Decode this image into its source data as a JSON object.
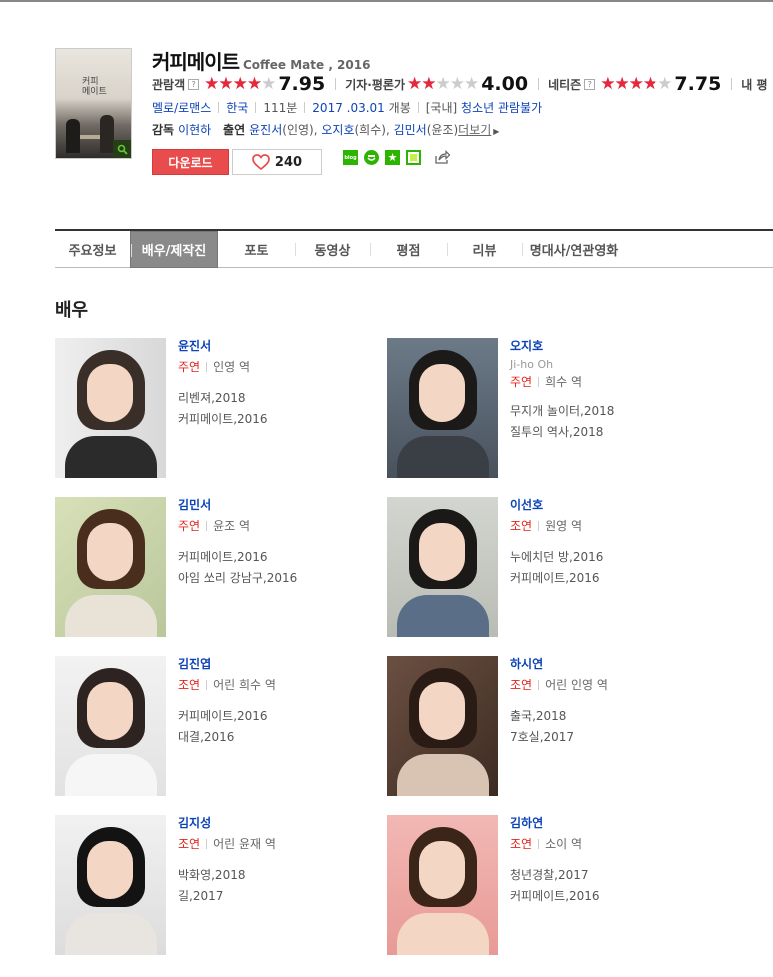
{
  "movie": {
    "title_ko": "커피메이트",
    "title_en": "Coffee Mate , 2016",
    "poster_text": "커피\n메이트",
    "ratings": [
      {
        "label": "관람객",
        "help": "?",
        "score": "7.95",
        "fill": 0.795
      },
      {
        "label": "기자·평론가",
        "help": "",
        "score": "4.00",
        "fill": 0.4
      },
      {
        "label": "네티즌",
        "help": "?",
        "score": "7.75",
        "fill": 0.775
      },
      {
        "label": "내 평",
        "help": "",
        "score": "",
        "fill": 0
      }
    ],
    "genre": "멜로/로맨스",
    "country": "한국",
    "runtime": "111분",
    "release_date": "2017 .03.01",
    "release_suffix": "개봉",
    "grade_prefix": "[국내]",
    "grade": "청소년 관람불가",
    "director_label": "감독",
    "director": "이현하",
    "cast_label": "출연",
    "cast_summary": [
      {
        "name": "윤진서",
        "role": "(인영)",
        "sep": ", "
      },
      {
        "name": "오지호",
        "role": "(희수)",
        "sep": ", "
      },
      {
        "name": "김민서",
        "role": "(윤조)",
        "sep": ""
      }
    ],
    "more_label": "더보기",
    "more_icon": "triangle-right-icon"
  },
  "actions": {
    "download_label": "다운로드",
    "like_count": "240",
    "like_icon": "heart-icon",
    "share_icons": [
      "blog-icon",
      "band-icon",
      "bookmark-star-icon",
      "memo-icon",
      "share-icon"
    ],
    "blog_text": "blog"
  },
  "tabs": [
    {
      "label": "주요정보",
      "active": false
    },
    {
      "label": "배우/제작진",
      "active": true
    },
    {
      "label": "포토",
      "active": false
    },
    {
      "label": "동영상",
      "active": false
    },
    {
      "label": "평점",
      "active": false
    },
    {
      "label": "리뷰",
      "active": false
    },
    {
      "label": "명대사/연관영화",
      "active": false
    }
  ],
  "section_title": "배우",
  "actors": [
    {
      "name": "윤진서",
      "en": "",
      "role_type": "주연",
      "role": "인영 역",
      "works": [
        "리벤져,2018",
        "커피메이트,2016"
      ]
    },
    {
      "name": "오지호",
      "en": "Ji-ho Oh",
      "role_type": "주연",
      "role": "희수 역",
      "works": [
        "무지개 놀이터,2018",
        "질투의 역사,2018"
      ]
    },
    {
      "name": "김민서",
      "en": "",
      "role_type": "주연",
      "role": "윤조 역",
      "works": [
        "커피메이트,2016",
        "아임 쏘리 강남구,2016"
      ]
    },
    {
      "name": "이선호",
      "en": "",
      "role_type": "조연",
      "role": "원영 역",
      "works": [
        "누에치던 방,2016",
        "커피메이트,2016"
      ]
    },
    {
      "name": "김진엽",
      "en": "",
      "role_type": "조연",
      "role": "어린 희수 역",
      "works": [
        "커피메이트,2016",
        "대결,2016"
      ]
    },
    {
      "name": "하시연",
      "en": "",
      "role_type": "조연",
      "role": "어린 인영 역",
      "works": [
        "출국,2018",
        "7호실,2017"
      ]
    },
    {
      "name": "김지성",
      "en": "",
      "role_type": "조연",
      "role": "어린 윤재 역",
      "works": [
        "박화영,2018",
        "길,2017"
      ]
    },
    {
      "name": "김하연",
      "en": "",
      "role_type": "조연",
      "role": "소이 역",
      "works": [
        "청년경찰,2017",
        "커피메이트,2016"
      ]
    }
  ],
  "colors": {
    "accent_red": "#e84c4c",
    "star_red": "#e6283d",
    "link_blue": "#0c43b7",
    "role_red": "#e1251b",
    "tab_active": "#8a8a8a",
    "naver_green": "#2db400"
  }
}
